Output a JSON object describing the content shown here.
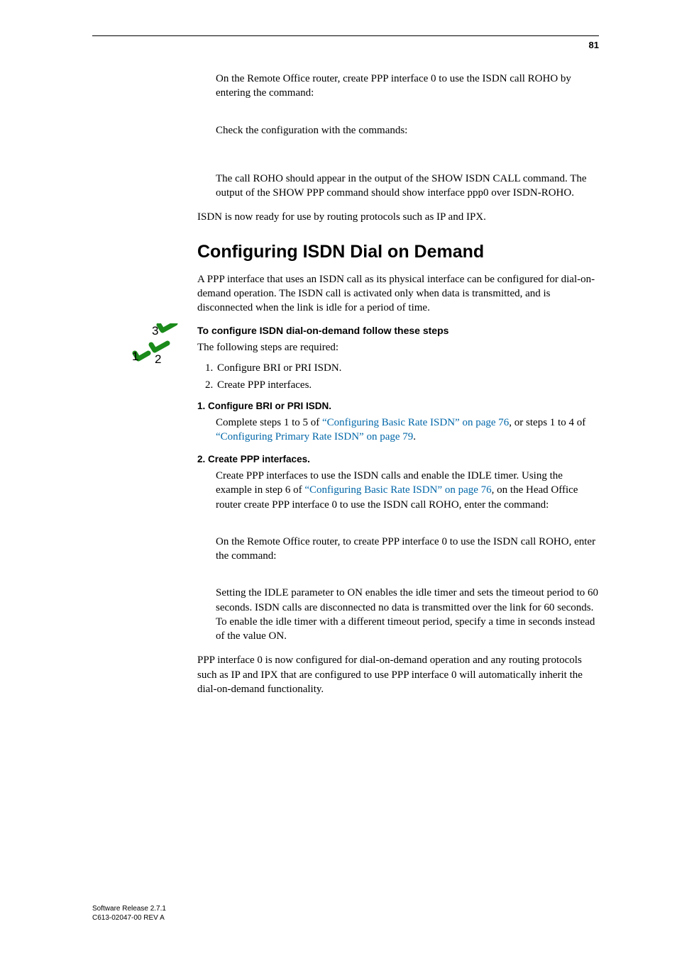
{
  "page_number": "81",
  "p1": "On the Remote Office router, create PPP interface 0 to use the ISDN call ROHO by entering the command:",
  "p2": "Check the configuration with the commands:",
  "p3": "The call ROHO should appear in the output of the SHOW ISDN CALL command. The output of the SHOW PPP command should show interface ppp0 over ISDN-ROHO.",
  "p4": "ISDN is now ready for use by routing protocols such as IP and IPX.",
  "section_title": "Configuring ISDN Dial on Demand",
  "p5": "A PPP interface that uses an ISDN call as its physical interface can be configured for dial-on-demand operation. The ISDN call is activated only when data is transmitted, and is disconnected when the link is idle for a period of time.",
  "proc_heading": "To configure ISDN dial-on-demand follow these steps",
  "p6": "The following steps are required:",
  "steps_overview": [
    "Configure BRI or PRI ISDN.",
    "Create PPP interfaces."
  ],
  "step1_heading": "1.   Configure BRI or PRI ISDN.",
  "step1_body_a": "Complete steps 1 to 5 of ",
  "step1_link1": "“Configuring Basic Rate ISDN” on page 76",
  "step1_body_b": ", or steps 1 to 4 of ",
  "step1_link2": "“Configuring Primary Rate ISDN” on page 79",
  "step1_body_c": ".",
  "step2_heading": "2.   Create PPP interfaces.",
  "step2_body_a": "Create PPP interfaces to use the ISDN calls and enable the IDLE timer. Using the example in step 6 of ",
  "step2_link1": "“Configuring Basic Rate ISDN” on page 76",
  "step2_body_b": ", on the Head Office router create PPP interface 0 to use the ISDN call ROHO, enter the command:",
  "step2_p2": "On the Remote Office router, to create PPP interface 0 to use the ISDN call ROHO, enter the command:",
  "step2_p3": "Setting the IDLE parameter to ON enables the idle timer and sets the timeout period to 60 seconds. ISDN calls are disconnected no data is transmitted over the link for 60 seconds. To enable the idle timer with a different timeout period, specify a time in seconds instead of the value ON.",
  "p_final": "PPP interface 0 is now configured for dial-on-demand operation and any routing protocols such as IP and IPX that are configured to use PPP interface 0 will automatically inherit the dial-on-demand functionality.",
  "footer_line1": "Software Release 2.7.1",
  "footer_line2": "C613-02047-00 REV A"
}
